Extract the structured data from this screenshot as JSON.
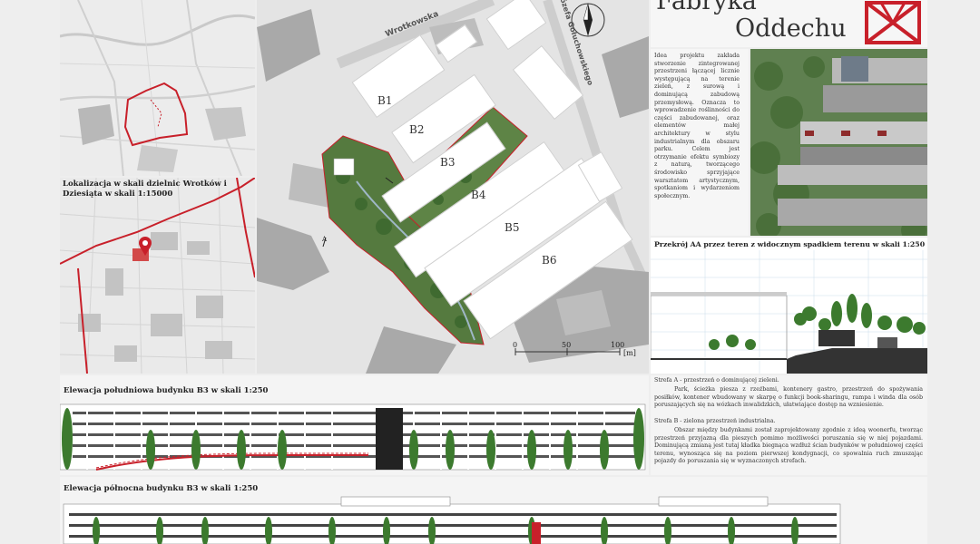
{
  "title": {
    "line1": "Fabryka",
    "line2": "Oddechu"
  },
  "location_map": {
    "caption": "Lokalizacja w skali dzielnic Wrotków i Dziesiąta w skali 1:15000"
  },
  "site_plan": {
    "buildings": [
      "B1",
      "B2",
      "B3",
      "B4",
      "B5",
      "B6"
    ],
    "street_labels": [
      "Wrotkowska",
      "Józefa Gołuchowskiego"
    ],
    "scale_ticks": [
      "0",
      "50",
      "100"
    ],
    "scale_unit": "[m]",
    "section_marker": "A"
  },
  "description": "Idea projektu zakłada stworzenie zintegrowanej przestrzeni łączącej licznie występującą na terenie zieleń, z surową i dominującą zabudową przemysłową. Oznacza to wprowadzenie roślinności do części zabudowanej, oraz elementów małej architektury w stylu industrialnym dla obszaru parku. Celem jest otrzymanie efektu symbiozy z naturą, tworzącego środowisko sprzyjające warsztatom artystycznym, spotkaniom i wydarzeniom społecznym.",
  "section": {
    "caption": "Przekrój AA przez teren z widocznym spadkiem terenu w skali 1:250"
  },
  "zones": {
    "zone_a_title": "Strefa A - przestrzeń o dominującej zieleni.",
    "zone_a_text": "Park, ścieżka piesza z rzeźbami, kontenery gastro, przestrzeń do spożywania posiłków, kontener wbudowany w skarpę o funkcji book-sharingu, rampa i winda dla osób poruszających się na wózkach inwalidzkich, ułatwiające dostęp na wzniesienie.",
    "zone_b_title": "Strefa B - zielona przestrzeń industrialna.",
    "zone_b_text": "Obszar między budynkami został zaprojektowany zgodnie z ideą woonerfu, tworząc przestrzeń przyjazną dla pieszych pomimo możliwości poruszania się w niej pojazdami. Dominującą zmianą jest tutaj kładka biegnąca wzdłuż ścian budynków w południowej części terenu, wynosząca się na poziom pierwszej kondygnacji, co spowalnia ruch zmuszając pojazdy do poruszania się w wyznaczonych strefach."
  },
  "elevation_south": {
    "caption": "Elewacja południowa budynku B3 w skali 1:250"
  },
  "elevation_north": {
    "caption": "Elewacja północna budynku B3 w skali 1:250"
  },
  "colors": {
    "accent_red": "#c8202a",
    "green": "#3c7a2e"
  }
}
